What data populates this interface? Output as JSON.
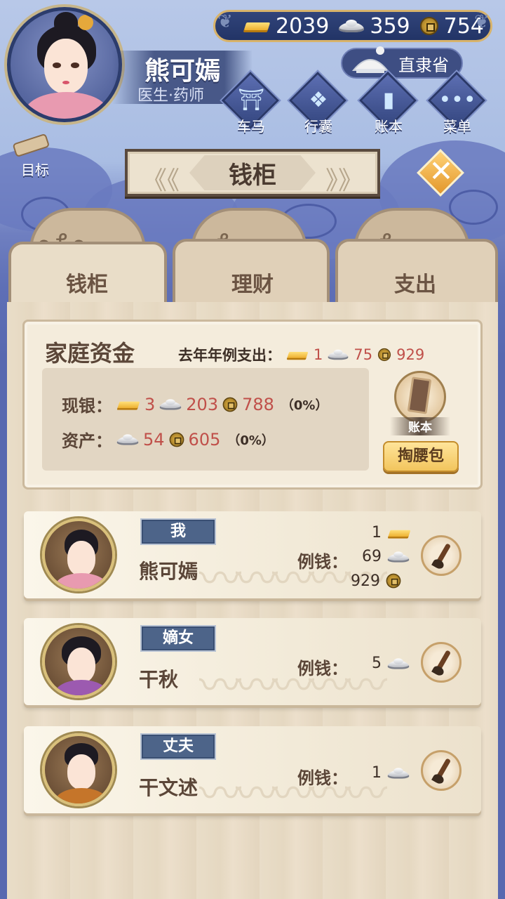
{
  "resources": {
    "gold": "2039",
    "silver": "359",
    "copper": "754"
  },
  "character": {
    "name": "熊可嫣",
    "title": "医生·药师"
  },
  "location": "直隶省",
  "nav": {
    "cart": "车马",
    "bag": "行囊",
    "ledger": "账本",
    "menu": "菜单"
  },
  "goal_label": "目标",
  "banner_title": "钱柜",
  "tabs": {
    "t0": "钱柜",
    "t1": "理财",
    "t2": "支出",
    "active": "钱柜"
  },
  "funds": {
    "title": "家庭资金",
    "expense_label": "去年年例支出：",
    "expense_gold": "1",
    "expense_silver": "75",
    "expense_copper": "929",
    "cash_label": "现银：",
    "cash_gold": "3",
    "cash_silver": "203",
    "cash_copper": "788",
    "cash_pct": "（0%）",
    "assets_label": "资产：",
    "assets_silver": "54",
    "assets_copper": "605",
    "assets_pct": "（0%）",
    "ledger_label": "账本",
    "pocket_button": "掏腰包"
  },
  "allowance_label": "例钱：",
  "members": [
    {
      "role": "我",
      "name": "熊可嫣",
      "gold": "1",
      "silver": "69",
      "copper": "929"
    },
    {
      "role": "嫡女",
      "name": "干秋",
      "silver": "5"
    },
    {
      "role": "丈夫",
      "name": "干文述",
      "silver": "1"
    }
  ],
  "colors": {
    "sky_blue": "#5868b0",
    "wood": "#e9ddc8",
    "role_tag": "#4d6489",
    "amount_red": "#c0504a",
    "accent_gold": "#f2c55d"
  }
}
